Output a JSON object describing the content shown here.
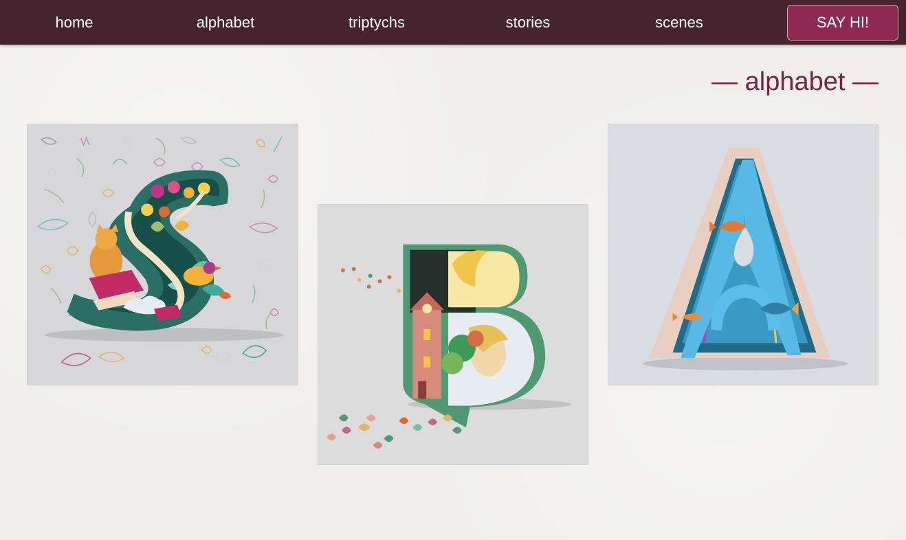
{
  "nav": {
    "items": [
      {
        "label": "home"
      },
      {
        "label": "alphabet"
      },
      {
        "label": "triptychs"
      },
      {
        "label": "stories"
      },
      {
        "label": "scenes"
      }
    ],
    "cta_label": "SAY HI!"
  },
  "section": {
    "title": "— alphabet —"
  },
  "gallery": {
    "cards": [
      {
        "letter": "S",
        "icon": "paper-art-letter-s-image"
      },
      {
        "letter": "B",
        "icon": "paper-art-letter-b-image"
      },
      {
        "letter": "A",
        "icon": "paper-art-letter-a-image"
      }
    ]
  },
  "colors": {
    "nav_bg": "#45232f",
    "accent": "#8e2a52",
    "title": "#7a2344",
    "page_bg": "#efeeeb"
  }
}
